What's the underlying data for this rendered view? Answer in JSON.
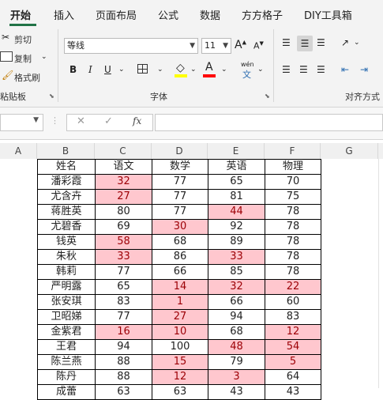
{
  "tabs": [
    {
      "label": "开始",
      "active": true
    },
    {
      "label": "插入"
    },
    {
      "label": "页面布局"
    },
    {
      "label": "公式"
    },
    {
      "label": "数据"
    },
    {
      "label": "方方格子"
    },
    {
      "label": "DIY工具箱"
    }
  ],
  "clipboard": {
    "cut": "剪切",
    "copy": "复制",
    "format_painter": "格式刷",
    "group": "粘贴板"
  },
  "font": {
    "name": "等线",
    "size": "11",
    "grow": "A",
    "shrink": "A",
    "bold": "B",
    "italic": "I",
    "underline": "U",
    "fill_letter": "◇",
    "font_letter": "A",
    "phonetic_top": "wén",
    "phonetic_bottom": "文",
    "group": "字体"
  },
  "alignment": {
    "group": "对齐方式"
  },
  "formula_bar": {
    "cancel": "✕",
    "confirm": "✓",
    "fx": "fx",
    "value": ""
  },
  "colors": {
    "accent": "#217346",
    "highlight_fill": "#ffc7ce",
    "highlight_text": "#9c0006",
    "fill_swatch": "#ffff00",
    "font_swatch": "#ff0000"
  },
  "columns": [
    "A",
    "B",
    "C",
    "D",
    "E",
    "F",
    "G"
  ],
  "table": {
    "headers": [
      "姓名",
      "语文",
      "数学",
      "英语",
      "物理"
    ],
    "rows": [
      [
        "潘彩霞",
        "32",
        "77",
        "65",
        "70"
      ],
      [
        "尤含卉",
        "27",
        "77",
        "81",
        "75"
      ],
      [
        "蒋胜英",
        "80",
        "77",
        "44",
        "78"
      ],
      [
        "尤碧香",
        "69",
        "30",
        "92",
        "78"
      ],
      [
        "钱英",
        "58",
        "68",
        "89",
        "78"
      ],
      [
        "朱秋",
        "33",
        "86",
        "33",
        "78"
      ],
      [
        "韩莉",
        "77",
        "66",
        "85",
        "78"
      ],
      [
        "严明露",
        "65",
        "14",
        "32",
        "22"
      ],
      [
        "张安琪",
        "83",
        "1",
        "66",
        "60"
      ],
      [
        "卫昭娣",
        "77",
        "27",
        "94",
        "83"
      ],
      [
        "金紫君",
        "16",
        "10",
        "68",
        "12"
      ],
      [
        "王君",
        "94",
        "100",
        "48",
        "54"
      ],
      [
        "陈兰燕",
        "88",
        "15",
        "79",
        "5"
      ],
      [
        "陈丹",
        "88",
        "12",
        "3",
        "64"
      ],
      [
        "成蕾",
        "63",
        "63",
        "43",
        "43"
      ]
    ],
    "highlighted": [
      [
        0,
        1
      ],
      [
        1,
        1
      ],
      [
        2,
        3
      ],
      [
        3,
        2
      ],
      [
        4,
        1
      ],
      [
        5,
        1
      ],
      [
        5,
        3
      ],
      [
        7,
        2
      ],
      [
        7,
        3
      ],
      [
        7,
        4
      ],
      [
        8,
        2
      ],
      [
        9,
        2
      ],
      [
        10,
        1
      ],
      [
        10,
        2
      ],
      [
        10,
        4
      ],
      [
        11,
        3
      ],
      [
        11,
        4
      ],
      [
        12,
        2
      ],
      [
        12,
        4
      ],
      [
        13,
        2
      ],
      [
        13,
        3
      ]
    ]
  }
}
